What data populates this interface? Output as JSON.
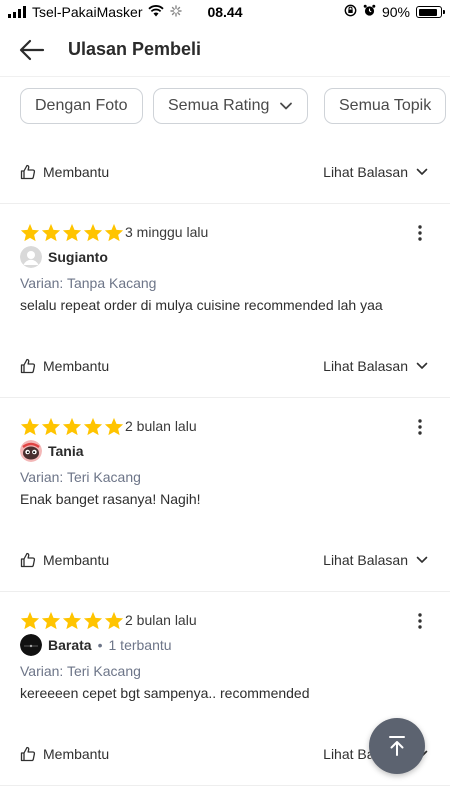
{
  "status_bar": {
    "carrier": "Tsel-PakaiMasker",
    "time": "08.44",
    "battery": "90%",
    "battery_level": 0.9
  },
  "header": {
    "title": "Ulasan Pembeli",
    "back_icon": "arrow-left-icon"
  },
  "filters": [
    {
      "label": "Dengan Foto"
    },
    {
      "label": "Semua Rating"
    },
    {
      "label": "Semua Topik"
    }
  ],
  "actions": {
    "helpful_label": "Membantu",
    "see_replies_label": "Lihat Balasan"
  },
  "reviews": [
    {
      "rating": 5,
      "date": "3 minggu lalu",
      "user": "Sugianto",
      "helped": "",
      "variant": "Varian: Tanpa Kacang",
      "text": "selalu repeat order di mulya cuisine recommended lah yaa"
    },
    {
      "rating": 5,
      "date": "2 bulan lalu",
      "user": "Tania",
      "helped": "",
      "variant": "Varian: Teri Kacang",
      "text": "Enak banget rasanya! Nagih!"
    },
    {
      "rating": 5,
      "date": "2 bulan lalu",
      "user": "Barata",
      "helped": "1 terbantu",
      "variant": "Varian: Teri Kacang",
      "text": "kereeeen cepet bgt sampenya.. recommended"
    }
  ],
  "colors": {
    "star": "#FFC400",
    "fab": "#5C6370",
    "muted_text": "#6D7588"
  }
}
